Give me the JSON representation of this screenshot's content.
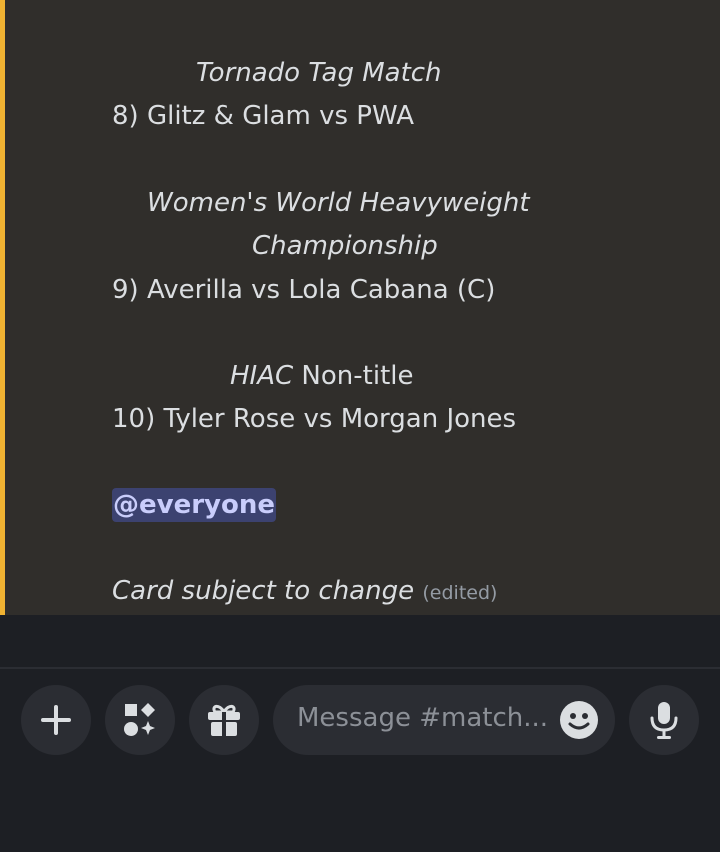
{
  "message": {
    "lines": [
      "Tornado Tag Match",
      "8) Glitz & Glam vs PWA",
      "Women's World Heavyweight",
      "Championship",
      "9) Averilla vs Lola Cabana (C)",
      "HIAC",
      " Non-title",
      "10)  Tyler Rose vs Morgan Jones",
      "@everyone",
      "Card subject to change",
      "(edited)"
    ]
  },
  "composer": {
    "placeholder": "Message #match...",
    "buttons": [
      "plus-icon",
      "apps-icon",
      "gift-icon",
      "microphone-icon"
    ]
  },
  "colors": {
    "accent": "#f0b232",
    "mention_bg": "#3c4270",
    "mention_text": "#c9cdfb"
  }
}
